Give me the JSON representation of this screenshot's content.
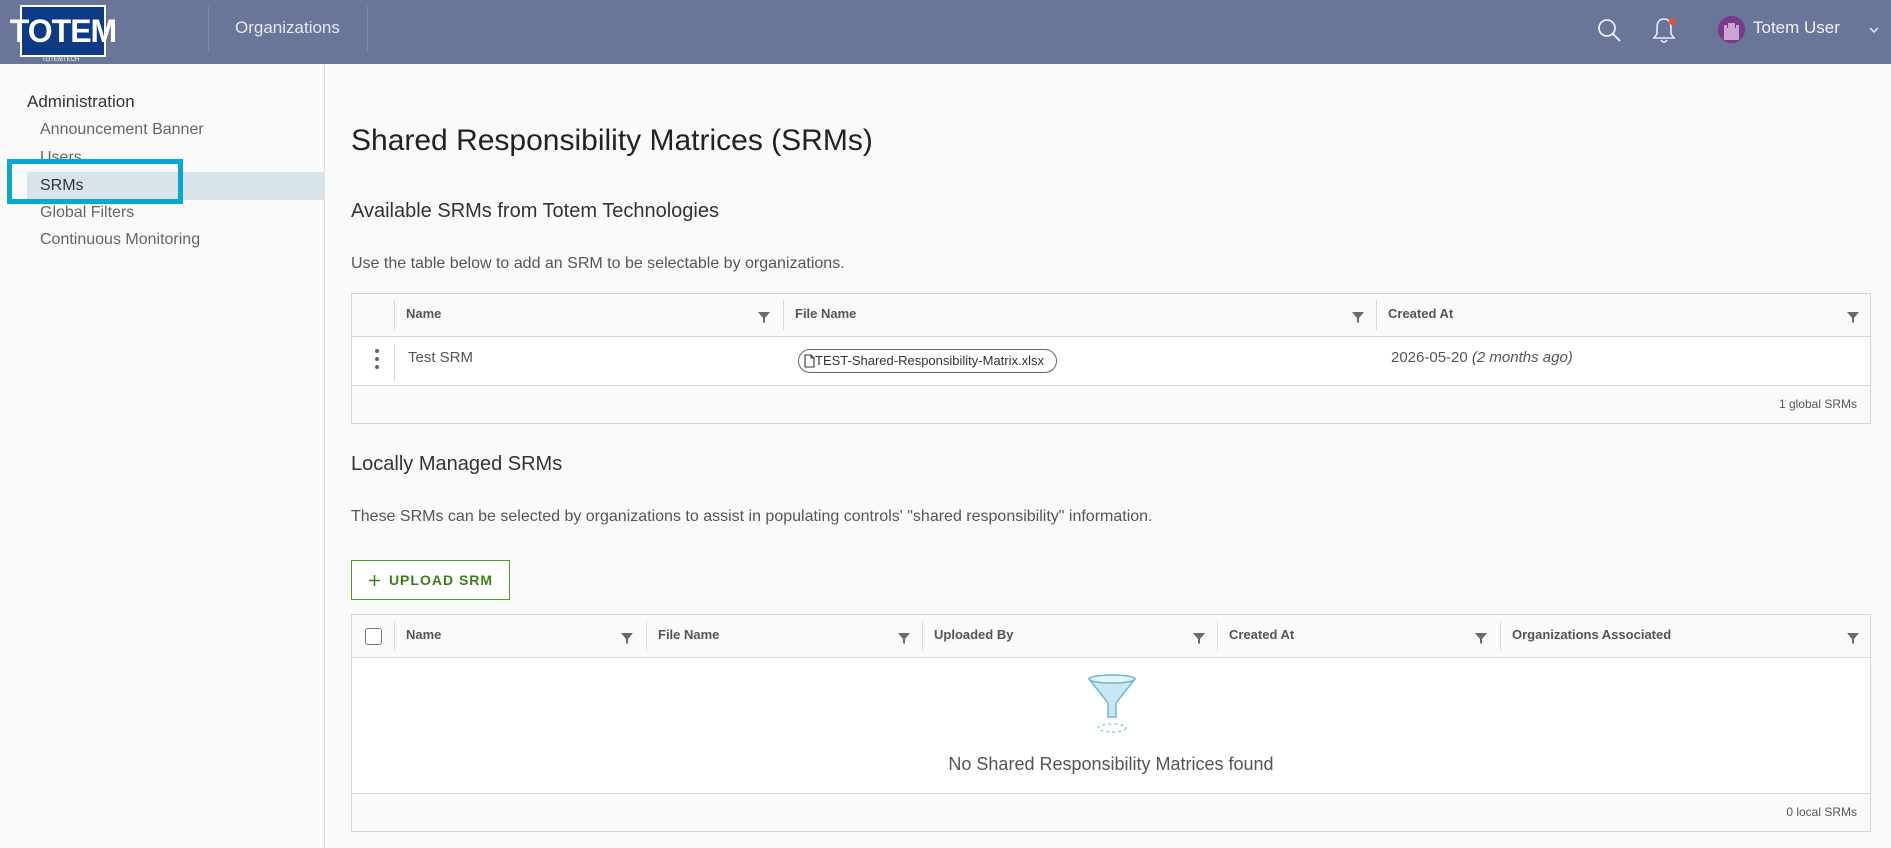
{
  "header": {
    "logo_text": "TOTEM",
    "logo_sub": "TOTEMTECH",
    "nav_organizations": "Organizations",
    "user_name": "Totem User",
    "icons": [
      "search-icon",
      "bell-icon",
      "avatar",
      "chevron-down-icon"
    ],
    "notification_dot_color": "#e3513d"
  },
  "sidebar": {
    "section": "Administration",
    "items": [
      {
        "label": "Announcement Banner"
      },
      {
        "label": "Users"
      },
      {
        "label": "SRMs",
        "active": true
      },
      {
        "label": "Global Filters"
      },
      {
        "label": "Continuous Monitoring"
      }
    ]
  },
  "main": {
    "title": "Shared Responsibility Matrices (SRMs)",
    "available": {
      "title": "Available SRMs from Totem Technologies",
      "description": "Use the table below to add an SRM to be selectable by organizations.",
      "columns": [
        "Name",
        "File Name",
        "Created At"
      ],
      "rows": [
        {
          "name": "Test SRM",
          "file_name": "TEST-Shared-Responsibility-Matrix.xlsx",
          "created_date": "2026-05-20",
          "created_relative": "(2 months ago)"
        }
      ],
      "footer": "1 global SRMs"
    },
    "local": {
      "title": "Locally Managed SRMs",
      "description": "These SRMs can be selected by organizations to assist in populating controls' \"shared responsibility\" information.",
      "upload_label": "UPLOAD SRM",
      "columns": [
        "Name",
        "File Name",
        "Uploaded By",
        "Created At",
        "Organizations Associated"
      ],
      "empty_message": "No Shared Responsibility Matrices found",
      "footer": "0 local SRMs"
    }
  },
  "colors": {
    "header_bg": "#697699",
    "active_item_bg": "#d8e3ea",
    "highlight_border": "#0aa7d3",
    "upload_green": "#3d7e1b"
  }
}
